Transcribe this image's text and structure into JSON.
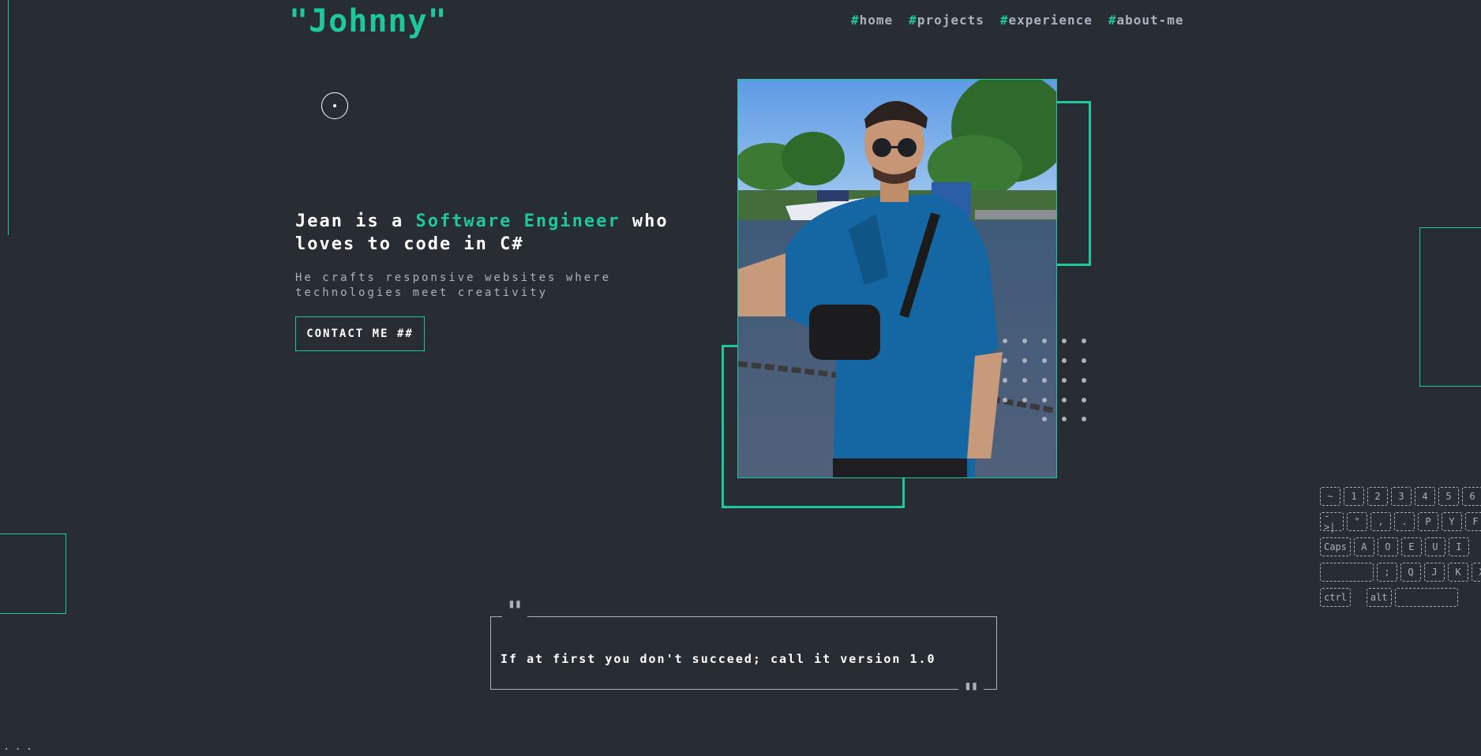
{
  "header": {
    "logo": "\"Johnny\"",
    "nav": [
      {
        "hash": "#",
        "label": "home"
      },
      {
        "hash": "#",
        "label": "projects"
      },
      {
        "hash": "#",
        "label": "experience"
      },
      {
        "hash": "#",
        "label": "about-me"
      }
    ]
  },
  "hero": {
    "title_start": "Jean is a ",
    "title_accent": "Software Engineer",
    "title_end": " who loves to code in C#",
    "subtitle": "He crafts responsive websites where technologies meet creativity",
    "contact_button": "CONTACT ME ##"
  },
  "quote": {
    "open_mark": "\"",
    "text": "If at first you don't succeed; call it version 1.0",
    "close_mark": "\""
  },
  "keyboard": {
    "rows": [
      [
        "~",
        "1",
        "2",
        "3",
        "4",
        "5",
        "6"
      ],
      [
        "->|",
        "\"",
        ",",
        ".",
        "P",
        "Y",
        "F"
      ],
      [
        "Caps",
        "A",
        "O",
        "E",
        "U",
        "I"
      ],
      [
        "",
        ";",
        "Q",
        "J",
        "K",
        "X"
      ],
      [
        "ctrl",
        "alt",
        ""
      ]
    ]
  },
  "footer": {
    "ellipsis": "..."
  },
  "colors": {
    "background": "#282c33",
    "accent": "#1ec79c",
    "muted": "#abb2bf",
    "text": "#ffffff"
  }
}
